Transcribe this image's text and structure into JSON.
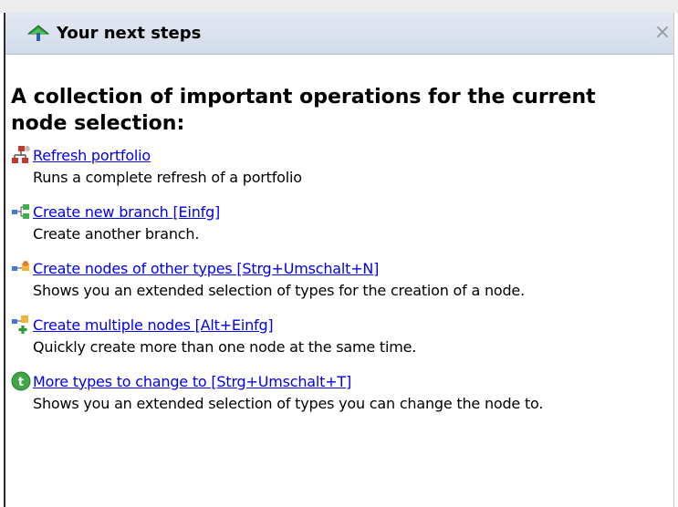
{
  "header": {
    "title": "Your next steps",
    "close_glyph": "×",
    "icon": "tree-arrow-icon"
  },
  "main": {
    "heading": "A collection of important operations for the current node selection:",
    "items": [
      {
        "icon": "refresh-portfolio-icon",
        "link": "Refresh portfolio",
        "description": "Runs a complete refresh of a portfolio"
      },
      {
        "icon": "new-branch-icon",
        "link": "Create new branch [Einfg]",
        "description": "Create another branch."
      },
      {
        "icon": "other-types-node-icon",
        "link": "Create nodes of other types [Strg+Umschalt+N]",
        "description": "Shows you an extended selection of types for the creation of a node."
      },
      {
        "icon": "multiple-nodes-icon",
        "link": "Create multiple nodes [Alt+Einfg]",
        "description": "Quickly create more than one node at the same time."
      },
      {
        "icon": "change-type-icon",
        "link": "More types to change to [Strg+Umschalt+T]",
        "description": "Shows you an extended selection of types you can change the node to."
      }
    ]
  }
}
